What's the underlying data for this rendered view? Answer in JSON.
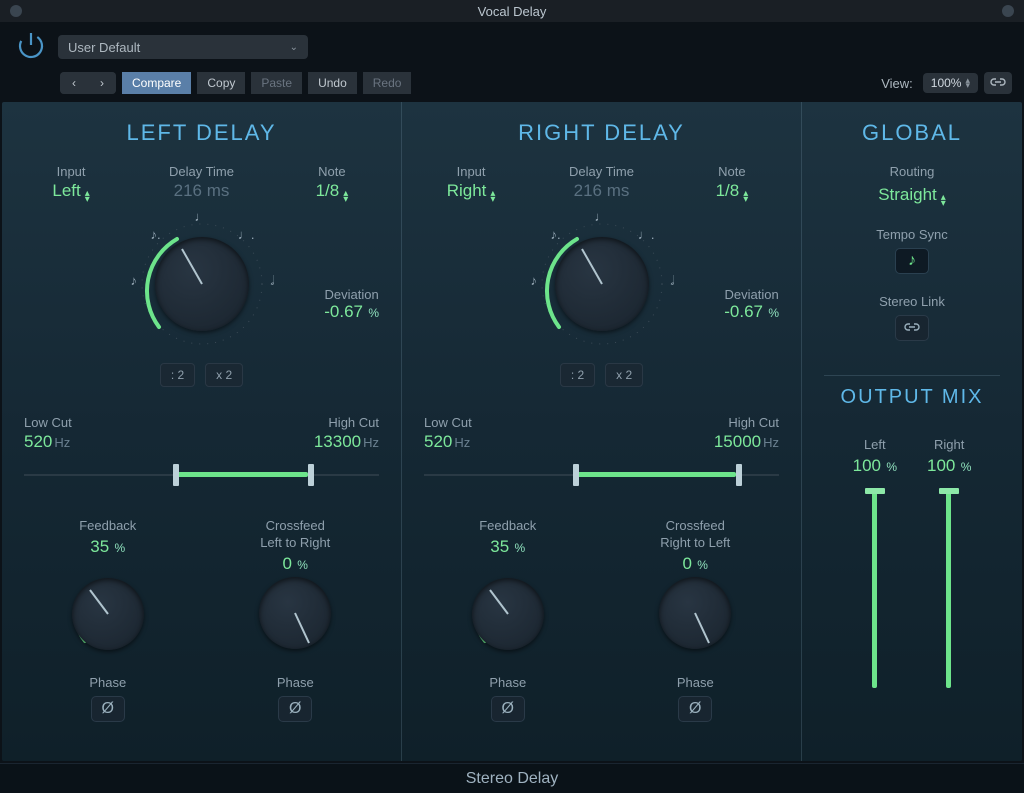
{
  "title": "Vocal Delay",
  "preset": "User Default",
  "toolbar": {
    "compare": "Compare",
    "copy": "Copy",
    "paste": "Paste",
    "undo": "Undo",
    "redo": "Redo",
    "view_label": "View:",
    "zoom": "100%"
  },
  "left": {
    "title": "LEFT DELAY",
    "input_label": "Input",
    "input_value": "Left",
    "delaytime_label": "Delay Time",
    "delaytime_value": "216 ms",
    "note_label": "Note",
    "note_value": "1/8",
    "deviation_label": "Deviation",
    "deviation_value": "-0.67",
    "div2": ": 2",
    "mul2": "x 2",
    "lowcut_label": "Low Cut",
    "lowcut_value": "520",
    "lowcut_unit": "Hz",
    "highcut_label": "High Cut",
    "highcut_value": "13300",
    "highcut_unit": "Hz",
    "feedback_label": "Feedback",
    "feedback_value": "35",
    "crossfeed_label": "Crossfeed",
    "crossfeed_dir": "Left to Right",
    "crossfeed_value": "0",
    "phase_label": "Phase"
  },
  "right": {
    "title": "RIGHT DELAY",
    "input_label": "Input",
    "input_value": "Right",
    "delaytime_label": "Delay Time",
    "delaytime_value": "216 ms",
    "note_label": "Note",
    "note_value": "1/8",
    "deviation_label": "Deviation",
    "deviation_value": "-0.67",
    "div2": ": 2",
    "mul2": "x 2",
    "lowcut_label": "Low Cut",
    "lowcut_value": "520",
    "lowcut_unit": "Hz",
    "highcut_label": "High Cut",
    "highcut_value": "15000",
    "highcut_unit": "Hz",
    "feedback_label": "Feedback",
    "feedback_value": "35",
    "crossfeed_label": "Crossfeed",
    "crossfeed_dir": "Right to Left",
    "crossfeed_value": "0",
    "phase_label": "Phase"
  },
  "global": {
    "title": "GLOBAL",
    "routing_label": "Routing",
    "routing_value": "Straight",
    "tempo_label": "Tempo Sync",
    "stereo_label": "Stereo Link",
    "output_title": "OUTPUT MIX",
    "left_label": "Left",
    "left_value": "100",
    "right_label": "Right",
    "right_value": "100"
  },
  "footer": "Stereo Delay"
}
